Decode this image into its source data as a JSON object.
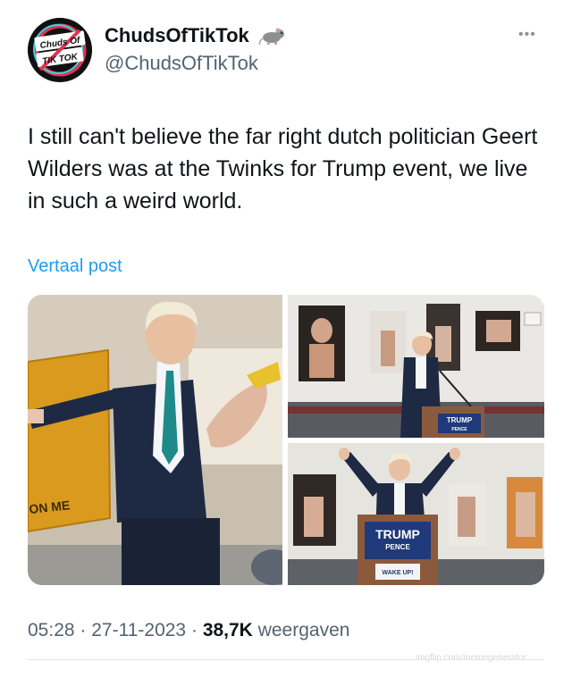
{
  "author": {
    "display_name": "ChudsOfTikTok",
    "username": "@ChudsOfTikTok",
    "badge_icon": "rat-icon",
    "avatar_text": [
      "Chuds Of",
      "TIK TOK"
    ]
  },
  "menu": {
    "more_label": "•••"
  },
  "post": {
    "text": "I still can't believe the far right dutch politician Geert Wilders was at the Twinks for Trump event, we live in such a weird world.",
    "translate_label": "Vertaal post"
  },
  "media": {
    "tiles": [
      {
        "name": "photo-left",
        "flag_text": "ON ME"
      },
      {
        "name": "photo-top-right",
        "podium_text": [
          "TRUMP",
          "PENCE"
        ]
      },
      {
        "name": "photo-bottom-right",
        "podium_text": [
          "TRUMP",
          "PENCE"
        ],
        "sign_text": "WAKE UP!"
      }
    ]
  },
  "footer": {
    "time": "05:28",
    "separator": "·",
    "date": "27-11-2023",
    "views_count": "38,7K",
    "views_label": "weergaven"
  },
  "watermark": "imgflip.com/memegenerator",
  "colors": {
    "text": "#0f1419",
    "secondary": "#536471",
    "link": "#1d9bf0",
    "divider": "#e1e5e8"
  }
}
